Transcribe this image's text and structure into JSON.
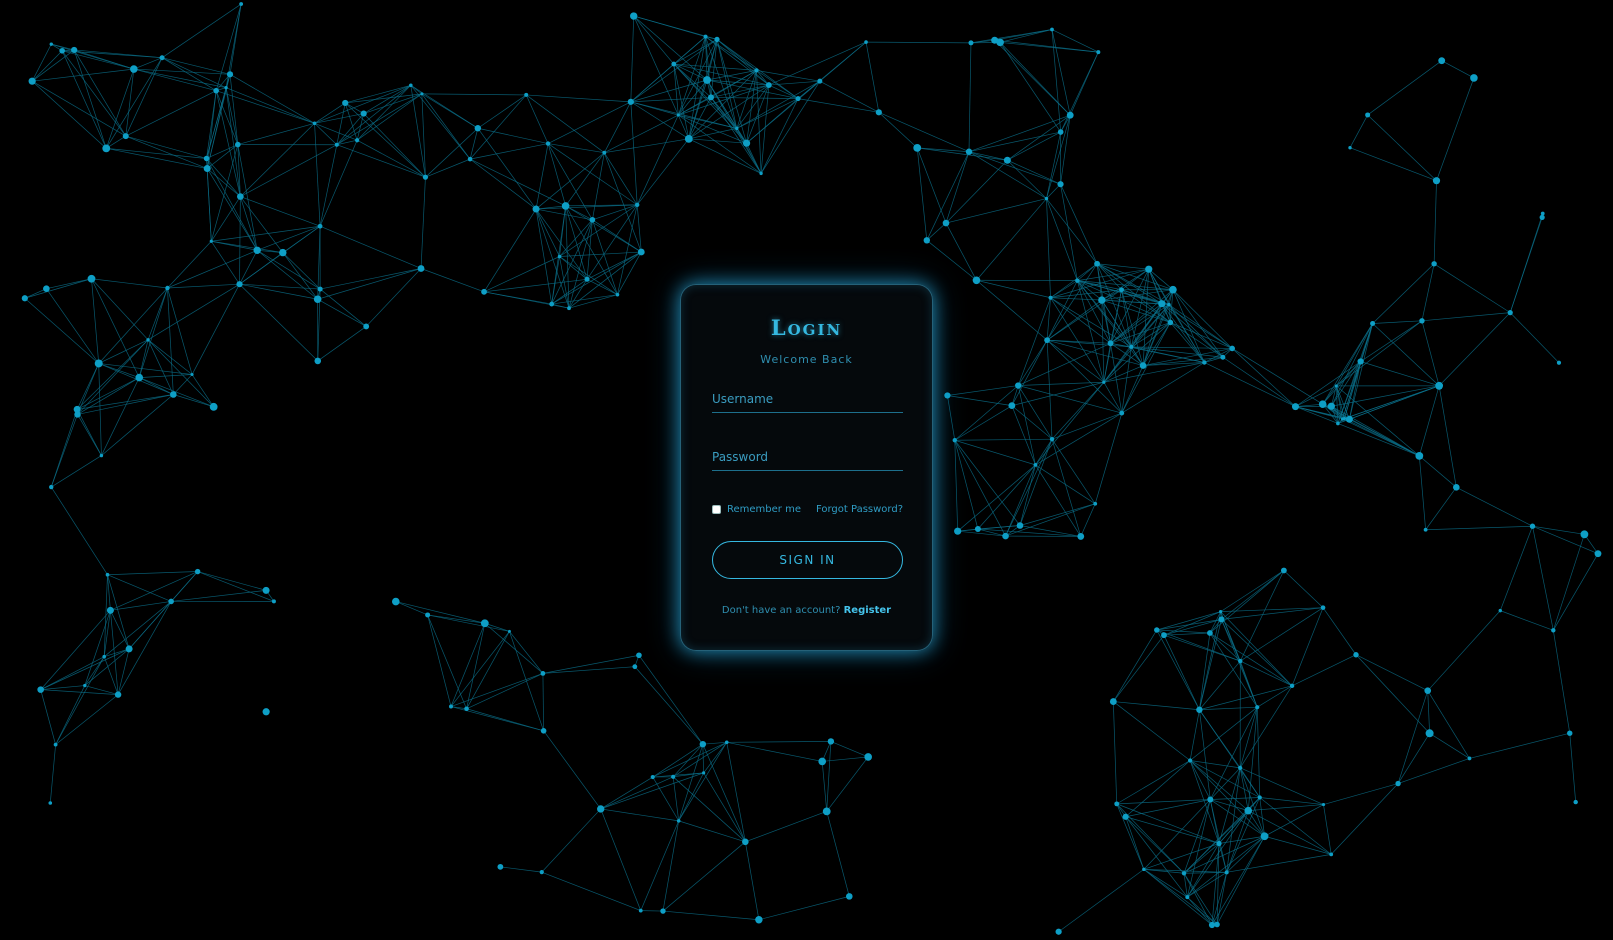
{
  "login": {
    "title": "Login",
    "subtitle": "Welcome Back",
    "username_placeholder": "Username",
    "password_placeholder": "Password",
    "remember_label": "Remember me",
    "forgot_label": "Forgot Password?",
    "submit_label": "SIGN IN",
    "no_account_text": "Don't have an account?",
    "register_label": "Register"
  },
  "theme": {
    "background": "#000000",
    "accent": "#35b8e0",
    "network_node": "#0e9fc6",
    "network_line": "#0a6f8a"
  }
}
